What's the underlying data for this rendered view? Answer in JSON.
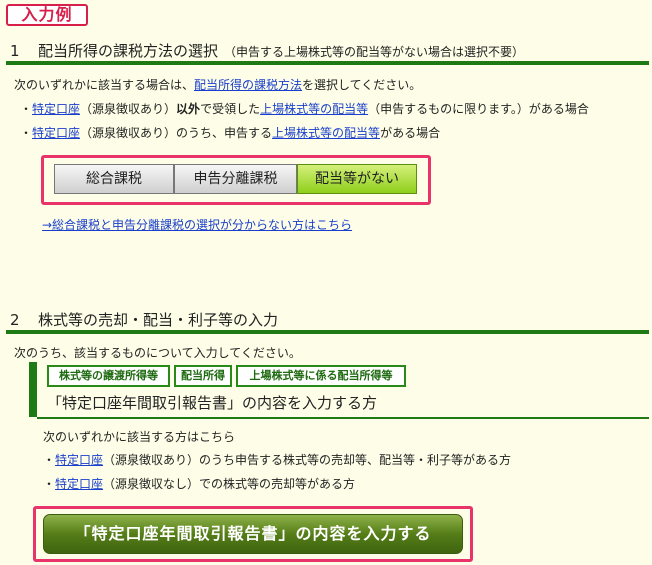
{
  "badge": "入力例",
  "section1": {
    "number": "1",
    "title": "配当所得の課税方法の選択",
    "note": "（申告する上場株式等の配当等がない場合は選択不要）",
    "intro_pre": "次のいずれかに該当する場合は、",
    "intro_link": "配当所得の課税方法",
    "intro_post": "を選択してください。",
    "bullet1_pre": "・",
    "bullet1_link1": "特定口座",
    "bullet1_mid1": "（源泉徴収あり）",
    "bullet1_bold": "以外",
    "bullet1_mid2": "で受領した",
    "bullet1_link2": "上場株式等の配当等",
    "bullet1_post": "（申告するものに限ります。）がある場合",
    "bullet2_pre": "・",
    "bullet2_link1": "特定口座",
    "bullet2_mid": "（源泉徴収あり）のうち、申告する",
    "bullet2_link2": "上場株式等の配当等",
    "bullet2_post": "がある場合",
    "options": [
      "総合課税",
      "申告分離課税",
      "配当等がない"
    ],
    "help_link": "→総合課税と申告分離課税の選択が分からない方はこちら"
  },
  "section2": {
    "number": "2",
    "title": "株式等の売却・配当・利子等の入力",
    "intro": "次のうち、該当するものについて入力してください。",
    "tags": [
      "株式等の譲渡所得等",
      "配当所得",
      "上場株式等に係る配当所得等"
    ],
    "subtitle": "「特定口座年間取引報告書」の内容を入力する方",
    "condition": "次のいずれかに該当する方はこちら",
    "bullet1_pre": "・",
    "bullet1_link": "特定口座",
    "bullet1_post": "（源泉徴収あり）のうち申告する株式等の売却等、配当等・利子等がある方",
    "bullet2_pre": "・",
    "bullet2_link": "特定口座",
    "bullet2_post": "（源泉徴収なし）での株式等の売却等がある方",
    "cta": "「特定口座年間取引報告書」の内容を入力する"
  }
}
